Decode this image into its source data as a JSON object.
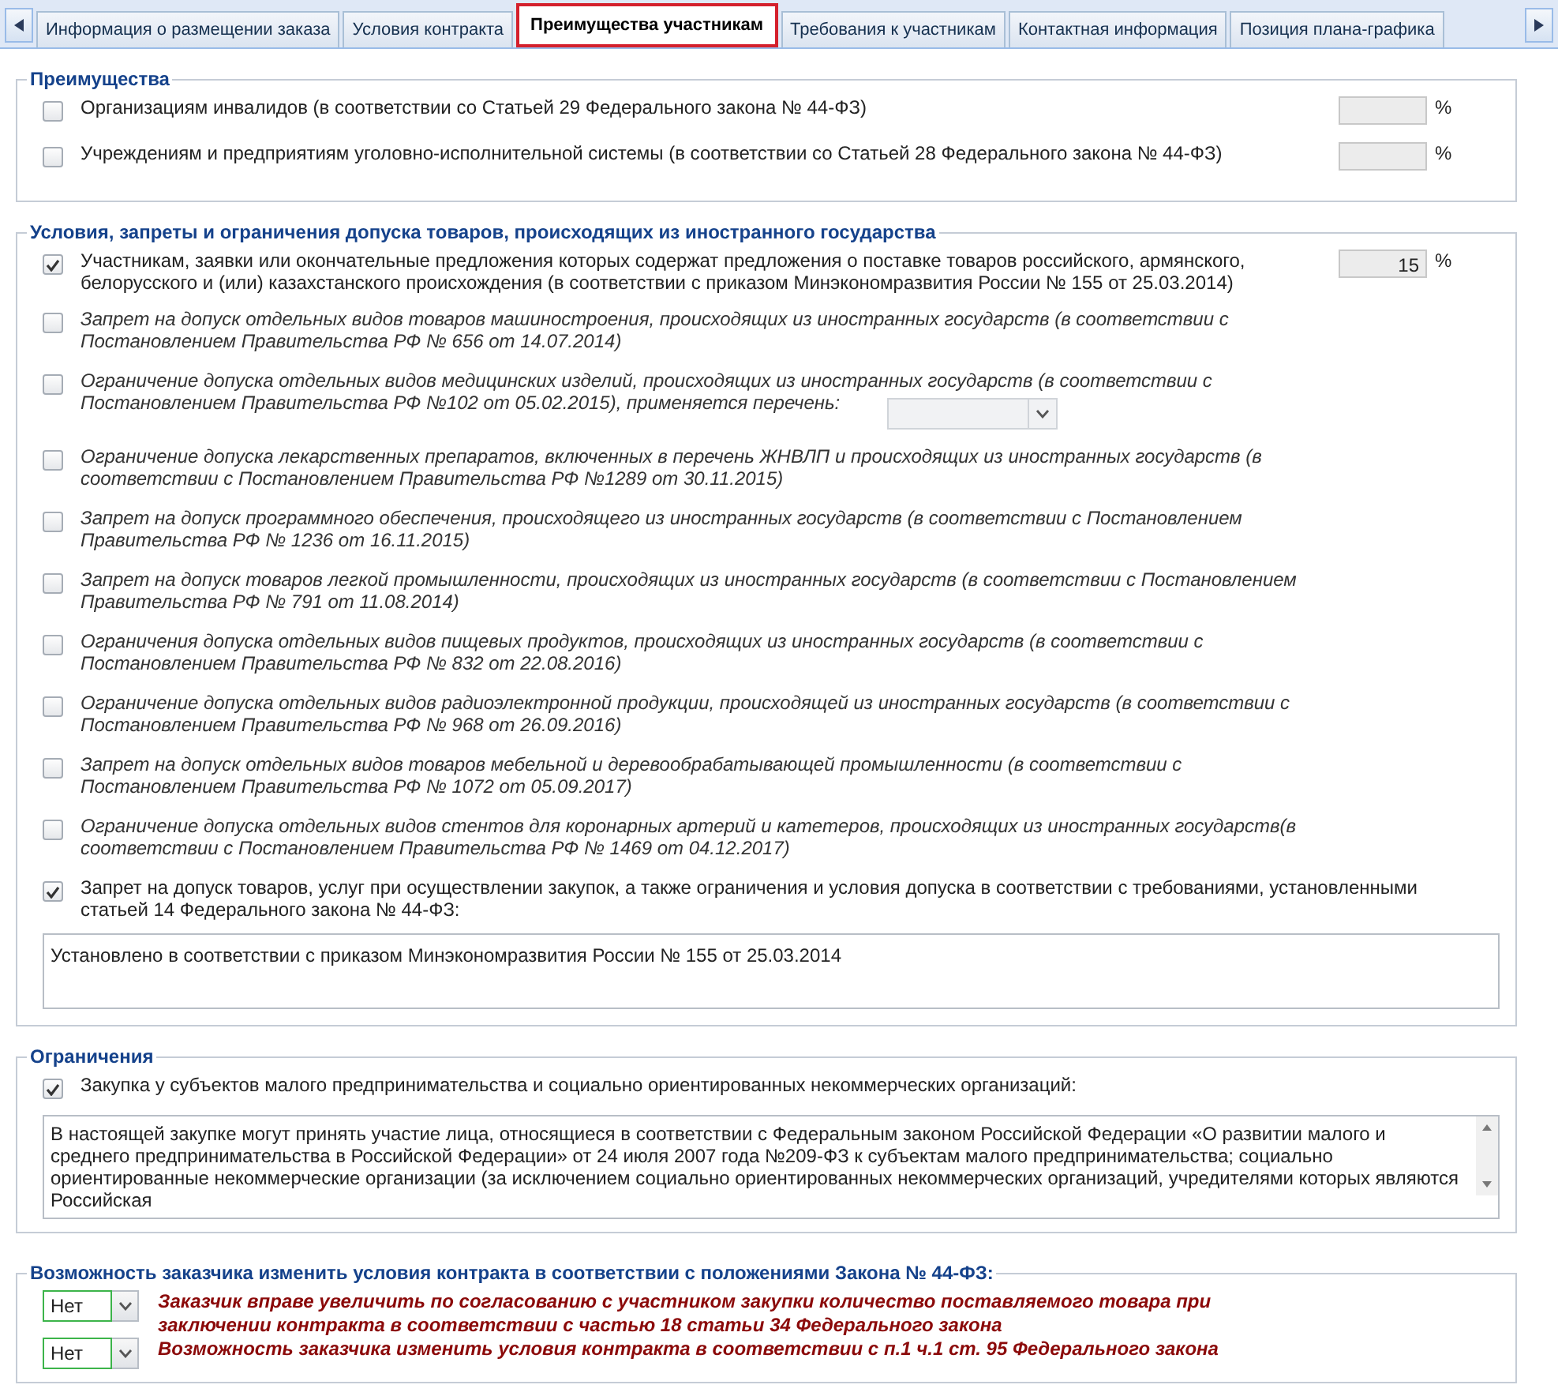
{
  "tabs": [
    {
      "label": "Информация о размещении заказа",
      "selected": false
    },
    {
      "label": "Условия контракта",
      "selected": false
    },
    {
      "label": "Преимущества участникам",
      "selected": true
    },
    {
      "label": "Требования к участникам",
      "selected": false
    },
    {
      "label": "Контактная информация",
      "selected": false
    },
    {
      "label": "Позиция плана-графика",
      "selected": false
    }
  ],
  "sections": [
    {
      "title": "Преимущества",
      "items": [
        {
          "kind": "percent",
          "label": "Организациям инвалидов (в соответствии со Статьей 29 Федерального закона № 44-ФЗ)",
          "checked": false,
          "unit": "%"
        },
        {
          "kind": "percent",
          "label": "Учреждениям и предприятиям уголовно-исполнительной системы (в соответствии со Статьей 28 Федерального закона № 44-ФЗ)",
          "checked": false,
          "unit": "%"
        }
      ]
    },
    {
      "title": "Условия, запреты и ограничения допуска товаров, происходящих из иностранного государства",
      "items": [
        {
          "kind": "percent",
          "label": "Участникам, заявки или окончательные предложения которых содержат предложения о поставке товаров российского, армянского, белорусского и (или) казахстанского происхождения (в соответствии с приказом Минэкономразвития России № 155 от 25.03.2014)",
          "checked": true,
          "value": "15",
          "unit": "%"
        },
        {
          "kind": "restriction",
          "label": "Запрет на допуск отдельных видов товаров машиностроения, происходящих из иностранных государств (в соответствии с Постановлением Правительства РФ № 656 от 14.07.2014)",
          "checked": false
        },
        {
          "kind": "restriction_list",
          "label": "Ограничение допуска отдельных видов медицинских изделий, происходящих из иностранных государств (в соответствии с Постановлением Правительства РФ №102 от 05.02.2015), применяется перечень:",
          "checked": false
        },
        {
          "kind": "restriction",
          "label": "Ограничение допуска лекарственных препаратов, включенных в перечень ЖНВЛП и происходящих из иностранных государств (в соответствии с Постановлением Правительства РФ №1289 от 30.11.2015)",
          "checked": false
        },
        {
          "kind": "restriction",
          "label": "Запрет на допуск программного обеспечения, происходящего из иностранных государств (в соответствии с Постановлением Правительства РФ № 1236 от 16.11.2015)",
          "checked": false
        },
        {
          "kind": "restriction",
          "label": "Запрет на допуск товаров легкой промышленности, происходящих из иностранных государств (в соответствии с Постановлением Правительства РФ № 791 от 11.08.2014)",
          "checked": false
        },
        {
          "kind": "restriction",
          "label": "Ограничения допуска отдельных видов пищевых продуктов, происходящих из иностранных государств (в соответствии с Постановлением Правительства РФ № 832 от 22.08.2016)",
          "checked": false
        },
        {
          "kind": "restriction",
          "label": "Ограничение допуска отдельных видов радиоэлектронной продукции, происходящей из иностранных государств (в соответствии с Постановлением Правительства РФ № 968 от 26.09.2016)",
          "checked": false
        },
        {
          "kind": "restriction",
          "label": "Запрет на допуск отдельных видов товаров мебельной и деревообрабатывающей промышленности (в соответствии с Постановлением Правительства РФ № 1072 от 05.09.2017)",
          "checked": false
        },
        {
          "kind": "restriction",
          "label": "Ограничение допуска отдельных видов стентов для коронарных артерий и катетеров, происходящих из иностранных государств(в соответствии с Постановлением Правительства РФ № 1469 от 04.12.2017)",
          "checked": false
        },
        {
          "kind": "note",
          "label": "Запрет на допуск товаров, услуг при осуществлении закупок, а также ограничения и условия допуска в соответствии с требованиями, установленными статьей 14 Федерального закона № 44-ФЗ:",
          "checked": true,
          "note": "Установлено в соответствии с приказом Минэкономразвития России № 155 от 25.03.2014"
        }
      ]
    },
    {
      "title": "Ограничения",
      "items": [
        {
          "kind": "scroll_note",
          "label": "Закупка у субъектов малого предпринимательства и социально ориентированных некоммерческих организаций:",
          "checked": true,
          "note": "В настоящей закупке могут принять участие лица, относящиеся в соответствии с Федеральным законом Российской Федерации «О развитии малого и среднего предпринимательства в Российской Федерации» от 24 июля 2007 года №209-ФЗ к субъектам малого предпринимательства; социально ориентированные некоммерческие организации (за исключением социально ориентированных некоммерческих организаций, учредителями которых являются Российская"
        }
      ]
    },
    {
      "title": "Возможность заказчика изменить условия контракта в соответствии с положениями Закона № 44-ФЗ:",
      "items": [
        {
          "kind": "choice",
          "value": "Нет",
          "label": "Заказчик вправе увеличить по согласованию с участником закупки количество поставляемого товара при заключении контракта в соответствии с частью 18 статьи 34 Федерального закона"
        },
        {
          "kind": "choice",
          "value": "Нет",
          "label": "Возможность заказчика изменить условия контракта в соответствии с п.1 ч.1 ст. 95 Федерального закона"
        }
      ]
    }
  ]
}
